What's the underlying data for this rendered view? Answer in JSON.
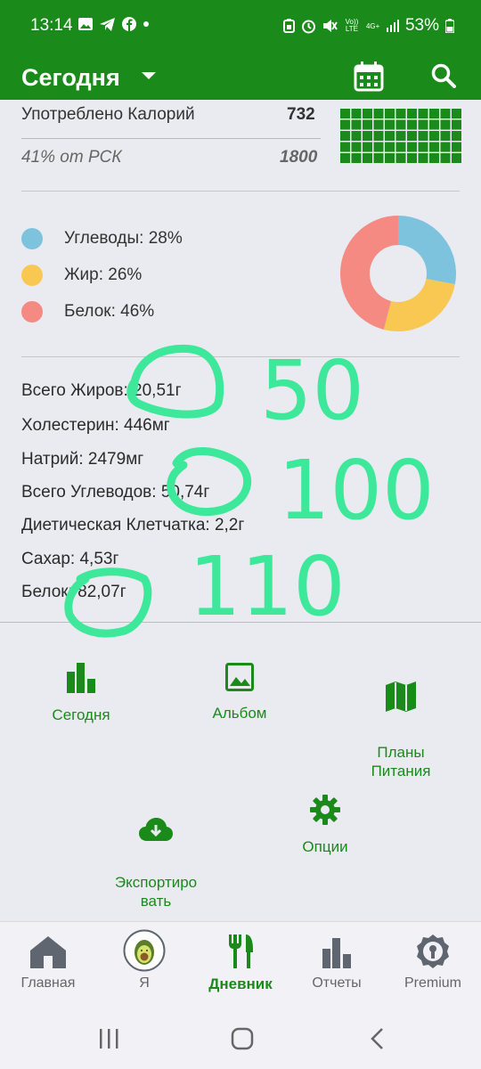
{
  "status_bar": {
    "time": "13:14",
    "battery": "53%",
    "network_label": "Vo)) LTE",
    "signal_label": "4G+"
  },
  "app_bar": {
    "title": "Сегодня"
  },
  "calories": {
    "label": "Употреблено Калорий",
    "value": "732",
    "rsk_label": "41% от РСК",
    "rsk_value": "1800"
  },
  "macros": [
    {
      "label": "Углеводы: 28%",
      "color": "#7ec3de",
      "percent": 28
    },
    {
      "label": "Жир: 26%",
      "color": "#f9c852",
      "percent": 26
    },
    {
      "label": "Белок: 46%",
      "color": "#f48a82",
      "percent": 46
    }
  ],
  "nutrients": [
    "Всего Жиров: 20,51г",
    "Холестерин: 446мг",
    "Натрий: 2479мг",
    "Всего Углеводов: 50,74г",
    "Диетическая Клетчатка: 2,2г",
    "Сахар: 4,53г",
    "Белок: 82,07г"
  ],
  "handwritten_notes": [
    "50",
    "100",
    "110"
  ],
  "actions": [
    {
      "label": "Сегодня",
      "icon": "bar-chart-icon"
    },
    {
      "label": "Альбом",
      "icon": "image-icon"
    },
    {
      "label": "Планы\nПитания",
      "icon": "map-icon"
    },
    {
      "label": "Экспортиро\nвать",
      "icon": "cloud-download-icon"
    },
    {
      "label": "Опции",
      "icon": "gear-icon"
    }
  ],
  "bottom_nav": [
    {
      "label": "Главная",
      "icon": "home-icon"
    },
    {
      "label": "Я",
      "icon": "avocado-avatar-icon"
    },
    {
      "label": "Дневник",
      "icon": "fork-knife-icon",
      "active": true
    },
    {
      "label": "Отчеты",
      "icon": "bar-chart-icon"
    },
    {
      "label": "Premium",
      "icon": "premium-badge-icon"
    }
  ],
  "colors": {
    "brand_green": "#1a8a1a",
    "annotation_green": "#3ee89a",
    "background": "#eaebf0"
  }
}
